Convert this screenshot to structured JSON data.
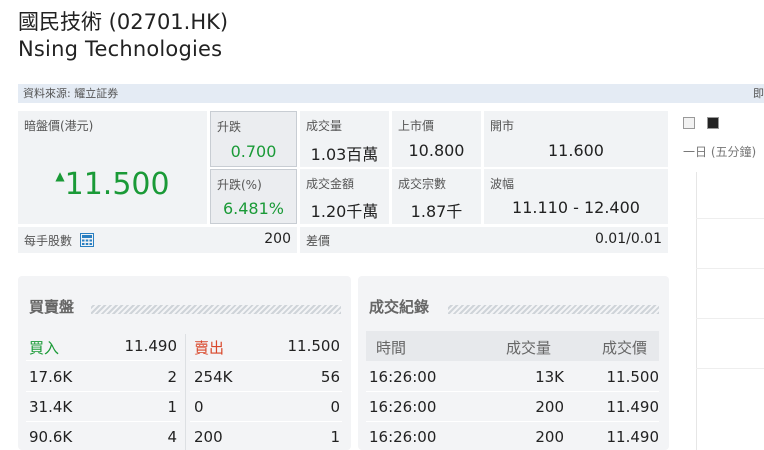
{
  "header": {
    "title_cn": "國民技術 (02701.HK)",
    "title_en": "Nsing Technologies"
  },
  "source_bar": {
    "text": "資料來源: 耀立証券",
    "edge": "即"
  },
  "quote": {
    "price_label": "暗盤價(港元)",
    "price": "11.500",
    "price_arrow": "▲",
    "change_label": "升跌",
    "change": "0.700",
    "change_pct_label": "升跌(%)",
    "change_pct": "6.481%",
    "volume_label": "成交量",
    "volume": "1.03百萬",
    "turnover_label": "成交金額",
    "turnover": "1.20千萬",
    "list_price_label": "上市價",
    "list_price": "10.800",
    "trades_label": "成交宗數",
    "trades": "1.87千",
    "open_label": "開市",
    "open": "11.600",
    "range_label": "波幅",
    "range": "11.110 - 12.400",
    "lot_label": "每手股數",
    "lot": "200",
    "spread_label": "差價",
    "spread": "0.01/0.01"
  },
  "chart": {
    "period_label": "一日 (五分鐘)"
  },
  "order_book": {
    "title": "買賣盤",
    "bid_label": "買入",
    "bid_price": "11.490",
    "ask_label": "賣出",
    "ask_price": "11.500",
    "bids": [
      {
        "qty": "17.6K",
        "count": "2"
      },
      {
        "qty": "31.4K",
        "count": "1"
      },
      {
        "qty": "90.6K",
        "count": "4"
      }
    ],
    "asks": [
      {
        "qty": "254K",
        "count": "56"
      },
      {
        "qty": "0",
        "count": "0"
      },
      {
        "qty": "200",
        "count": "1"
      }
    ]
  },
  "trade_log": {
    "title": "成交紀錄",
    "columns": [
      "時間",
      "成交量",
      "成交價"
    ],
    "rows": [
      {
        "time": "16:26:00",
        "volume": "13K",
        "price": "11.500"
      },
      {
        "time": "16:26:00",
        "volume": "200",
        "price": "11.490"
      },
      {
        "time": "16:26:00",
        "volume": "200",
        "price": "11.490"
      }
    ]
  }
}
